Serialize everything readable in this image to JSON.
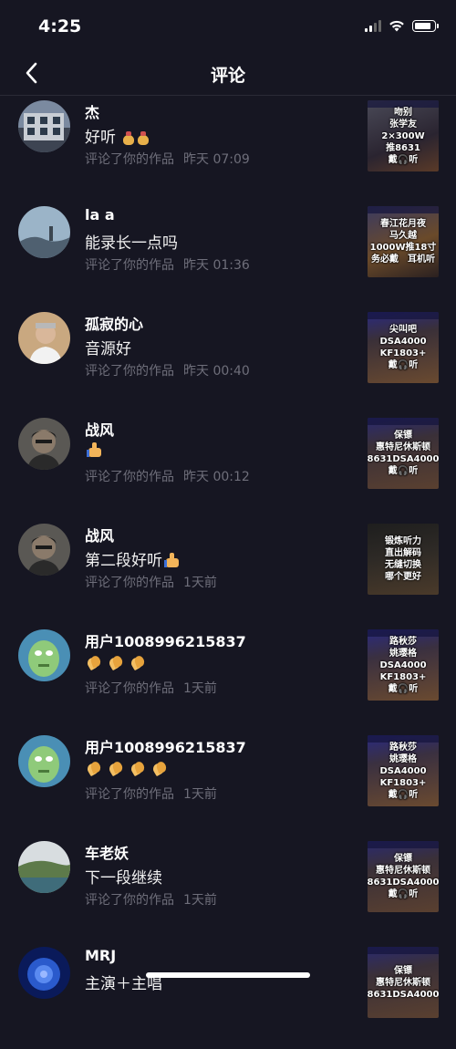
{
  "status_bar": {
    "time": "4:25"
  },
  "nav": {
    "title": "评论"
  },
  "comments": [
    {
      "user": "杰",
      "text": "好听",
      "action": "评论了你的作品",
      "time": "昨天 07:09",
      "thumb_lines": [
        "吻别",
        "张学友",
        "2×300W",
        "推8631",
        "戴🎧听"
      ],
      "thumb_color": "#3a3040"
    },
    {
      "user": "la a",
      "text": "能录长一点吗",
      "action": "评论了你的作品",
      "time": "昨天 01:36",
      "thumb_lines": [
        "春江花月夜",
        "马久越",
        "1000W推18寸",
        "务必戴　耳机听"
      ],
      "thumb_color": "#6a4a2a"
    },
    {
      "user": "孤寂的心",
      "text": "音源好",
      "action": "评论了你的作品",
      "time": "昨天 00:40",
      "thumb_lines": [
        "尖叫吧",
        "DSA4000",
        "KF1803+",
        "戴🎧听"
      ],
      "thumb_color": "#4a3a30"
    },
    {
      "user": "战风",
      "text": "",
      "action": "评论了你的作品",
      "time": "昨天 00:12",
      "thumb_lines": [
        "保镖",
        "惠特尼休斯顿",
        "8631DSA4000",
        "戴🎧听"
      ],
      "thumb_color": "#3a3038"
    },
    {
      "user": "战风",
      "text": "第二段好听",
      "action": "评论了你的作品",
      "time": "1天前",
      "thumb_lines": [
        "锻炼听力",
        "直出解码",
        "无缝切换",
        "哪个更好"
      ],
      "thumb_color": "#2a2824"
    },
    {
      "user": "用户1008996215837",
      "text": "",
      "action": "评论了你的作品",
      "time": "1天前",
      "thumb_lines": [
        "路秋莎",
        "姚璎格",
        "DSA4000",
        "KF1803+",
        "戴🎧听"
      ],
      "thumb_color": "#3a3040"
    },
    {
      "user": "用户1008996215837",
      "text": "",
      "action": "评论了你的作品",
      "time": "1天前",
      "thumb_lines": [
        "路秋莎",
        "姚璎格",
        "DSA4000",
        "KF1803+",
        "戴🎧听"
      ],
      "thumb_color": "#3a3040"
    },
    {
      "user": "车老妖",
      "text": "下一段继续",
      "action": "评论了你的作品",
      "time": "1天前",
      "thumb_lines": [
        "保镖",
        "惠特尼休斯顿",
        "8631DSA4000",
        "戴🎧听"
      ],
      "thumb_color": "#3a3038"
    },
    {
      "user": "MRJ",
      "text": "主演＋主唱",
      "action": "",
      "time": "",
      "thumb_lines": [
        "保镖",
        "惠特尼休斯顿",
        "8631DSA4000"
      ],
      "thumb_color": "#3a3038"
    }
  ],
  "icons": {
    "back": "chevron-left-icon",
    "emoji_money_bag": "money-bag-emoji-icon",
    "emoji_thumbs_up": "thumbs-up-emoji-icon",
    "emoji_clap": "clapping-hands-emoji-icon"
  },
  "colors": {
    "background": "#161622",
    "meta_text": "#6e6e7a"
  }
}
